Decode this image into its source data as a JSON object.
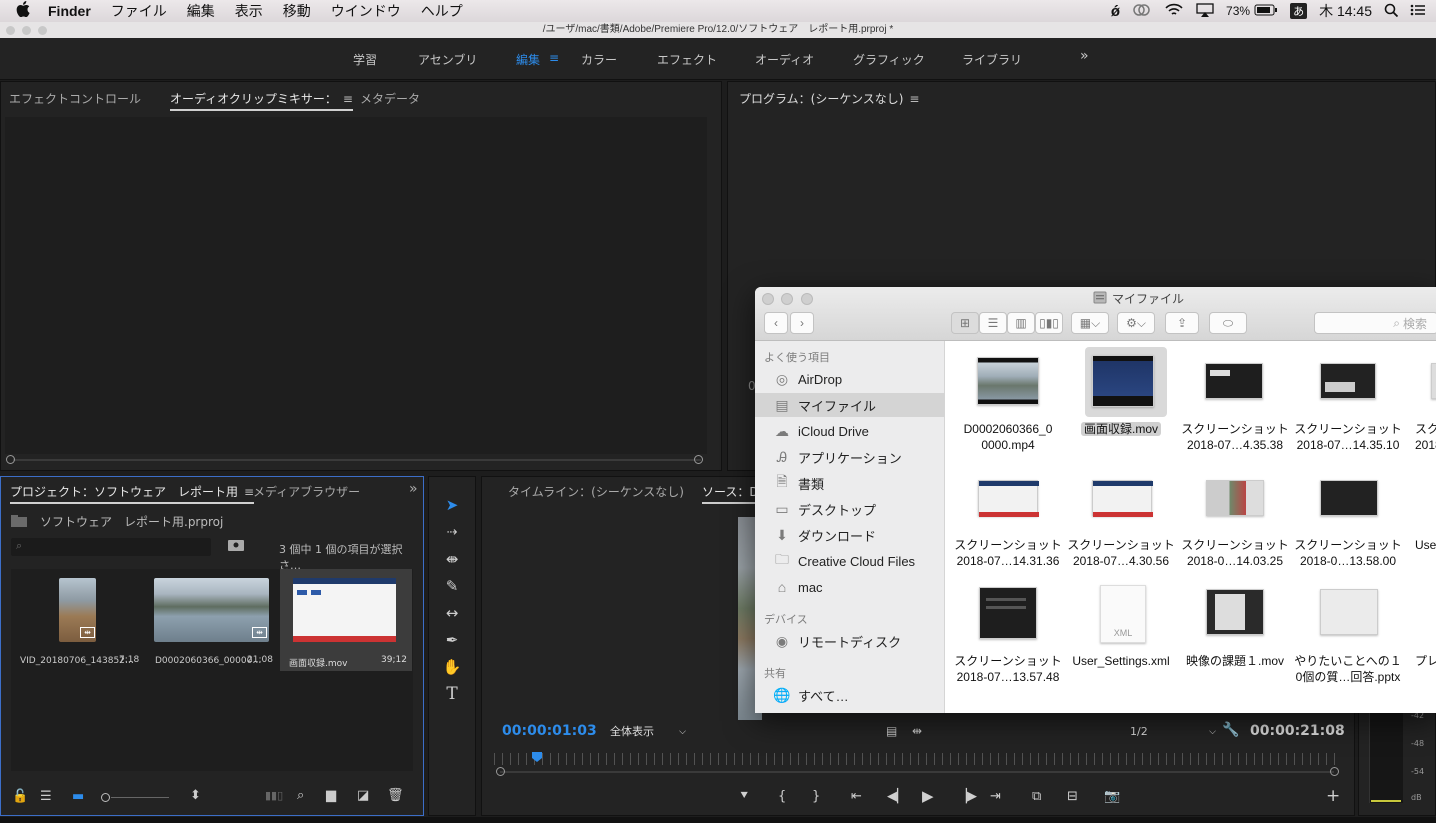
{
  "menubar": {
    "apple": "",
    "app": "Finder",
    "items": [
      "ファイル",
      "編集",
      "表示",
      "移動",
      "ウインドウ",
      "ヘルプ"
    ],
    "battery": "73%",
    "ime": "あ",
    "clock": "木 14:45"
  },
  "window_title": "/ユーザ/mac/書類/Adobe/Premiere Pro/12.0/ソフトウェア　レポート用.prproj *",
  "workspaces": [
    "学習",
    "アセンブリ",
    "編集",
    "カラー",
    "エフェクト",
    "オーディオ",
    "グラフィック",
    "ライブラリ"
  ],
  "workspace_more": "»",
  "effect_panel": {
    "tabs": [
      "エフェクトコントロール",
      "オーディオクリップミキサー：",
      "メタデータ"
    ],
    "menu": "≡"
  },
  "program_panel": {
    "title": "プログラム：(シーケンスなし)",
    "menu": "≡",
    "partial_char": "0"
  },
  "project_panel": {
    "tabs": [
      "プロジェクト：ソフトウェア　レポート用",
      "メディアブラウザー"
    ],
    "menu": "≡",
    "more": "»",
    "file": "ソフトウェア　レポート用.prproj",
    "selection_status": "3 個中 1 個の項目が選択さ…",
    "clips": [
      {
        "name": "VID_20180706_143852…",
        "duration": "7:18"
      },
      {
        "name": "D0002060366_00000…",
        "duration": "21:08"
      },
      {
        "name": "画面収録.mov",
        "duration": "39;12"
      }
    ]
  },
  "timeline_panel": {
    "tabs": [
      "タイムライン：(シーケンスなし)",
      "ソース：D0"
    ],
    "timecode": "00:00:01:03",
    "zoom_select": "全体表示",
    "resolution": "1/2",
    "duration": "00:00:21:08"
  },
  "audio_meter": {
    "labels": [
      "-42",
      "-48",
      "-54",
      "dB"
    ]
  },
  "finder": {
    "title": "マイファイル",
    "search_placeholder": "検索",
    "sidebar": {
      "favorites_header": "よく使う項目",
      "favorites": [
        {
          "label": "AirDrop",
          "icon": "airdrop-icon"
        },
        {
          "label": "マイファイル",
          "icon": "all-files-icon"
        },
        {
          "label": "iCloud Drive",
          "icon": "cloud-icon"
        },
        {
          "label": "アプリケーション",
          "icon": "applications-icon"
        },
        {
          "label": "書類",
          "icon": "documents-icon"
        },
        {
          "label": "デスクトップ",
          "icon": "desktop-icon"
        },
        {
          "label": "ダウンロード",
          "icon": "downloads-icon"
        },
        {
          "label": "Creative Cloud Files",
          "icon": "folder-icon"
        },
        {
          "label": "mac",
          "icon": "home-icon"
        }
      ],
      "devices_header": "デバイス",
      "devices": [
        {
          "label": "リモートディスク",
          "icon": "disc-icon"
        }
      ],
      "shared_header": "共有",
      "shared": [
        {
          "label": "すべて…",
          "icon": "network-icon"
        }
      ]
    },
    "files": [
      {
        "line1": "D0002060366_0",
        "line2": "0000.mp4"
      },
      {
        "line1": "画面収録.mov",
        "line2": ""
      },
      {
        "line1": "スクリーンショット",
        "line2": "2018-07…4.35.38"
      },
      {
        "line1": "スクリーンショット",
        "line2": "2018-07…14.35.10"
      },
      {
        "line1": "スク",
        "line2": "2018"
      },
      {
        "line1": "スクリーンショット",
        "line2": "2018-07…14.31.36"
      },
      {
        "line1": "スクリーンショット",
        "line2": "2018-07…4.30.56"
      },
      {
        "line1": "スクリーンショット",
        "line2": "2018-0…14.03.25"
      },
      {
        "line1": "スクリーンショット",
        "line2": "2018-0…13.58.00"
      },
      {
        "line1": "User",
        "line2": ""
      },
      {
        "line1": "スクリーンショット",
        "line2": "2018-07…13.57.48"
      },
      {
        "line1": "User_Settings.xml",
        "line2": ""
      },
      {
        "line1": "映像の課題１.mov",
        "line2": ""
      },
      {
        "line1": "やりたいことへの１",
        "line2": "0個の質…回答.pptx"
      },
      {
        "line1": "プレ",
        "line2": ""
      }
    ],
    "xml_badge": "XML"
  },
  "colors": {
    "accent_blue": "#2d8ceb",
    "finder_sidebar": "#ececed",
    "panel_bg": "#232323"
  }
}
